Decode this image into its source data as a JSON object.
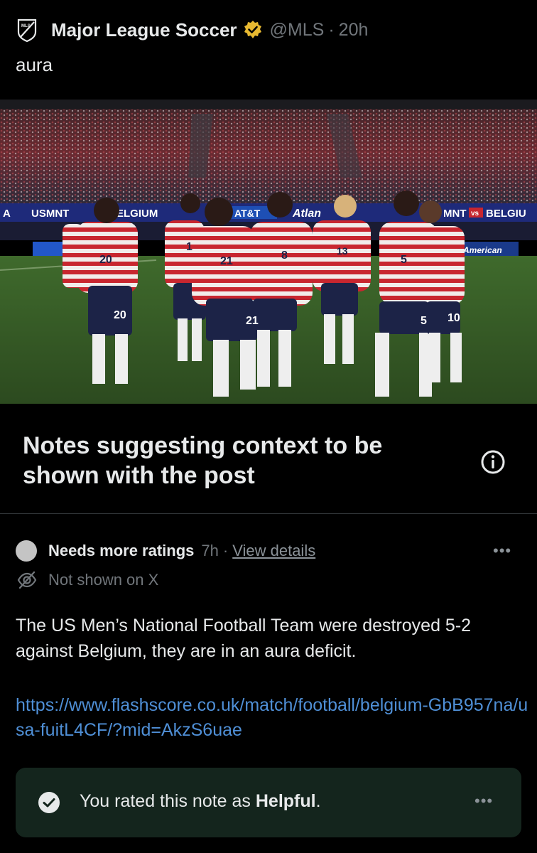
{
  "post": {
    "author_name": "Major League Soccer",
    "handle": "@MLS",
    "separator": "·",
    "time": "20h",
    "text": "aura"
  },
  "media": {
    "scoreboard": {
      "left": "A",
      "team1": "USMNT",
      "team2": "ELGIUM",
      "sponsor1": "AT&T",
      "sponsor2": "Atlan",
      "right_team1": "MNT",
      "vs": "vs",
      "right_team2": "BELGIU",
      "sponsor3": "American"
    },
    "jersey_numbers": [
      "20",
      "21",
      "8",
      "13",
      "5",
      "10",
      "1"
    ]
  },
  "notes": {
    "title": "Notes suggesting context to be shown with the post"
  },
  "note": {
    "status_label": "Needs more ratings",
    "age": "7h",
    "separator": "·",
    "view_details": "View details",
    "visibility": "Not shown on X",
    "body": "The US Men’s National Football Team were destroyed 5-2 against Belgium, they are in an aura deficit.",
    "link": "https://www.flashscore.co.uk/match/football/belgium-GbB957na/usa-fuitL4CF/?mid=AkzS6uae",
    "more": "•••"
  },
  "rating": {
    "prefix": "You rated this note as ",
    "value": "Helpful",
    "suffix": ".",
    "more": "•••"
  },
  "colors": {
    "background": "#000000",
    "text_primary": "#e7e9ea",
    "text_secondary": "#71767b",
    "link": "#4f8fd6",
    "verified_gold": "#e8b931",
    "rating_box": "#14251d",
    "divider": "#2f3336"
  },
  "icons": {
    "logo": "mls-logo-icon",
    "verified": "verified-badge-icon",
    "info": "info-icon",
    "status": "status-dot-icon",
    "visibility": "eye-off-icon",
    "rated": "checkmark-icon",
    "more": "more-dots-icon"
  }
}
